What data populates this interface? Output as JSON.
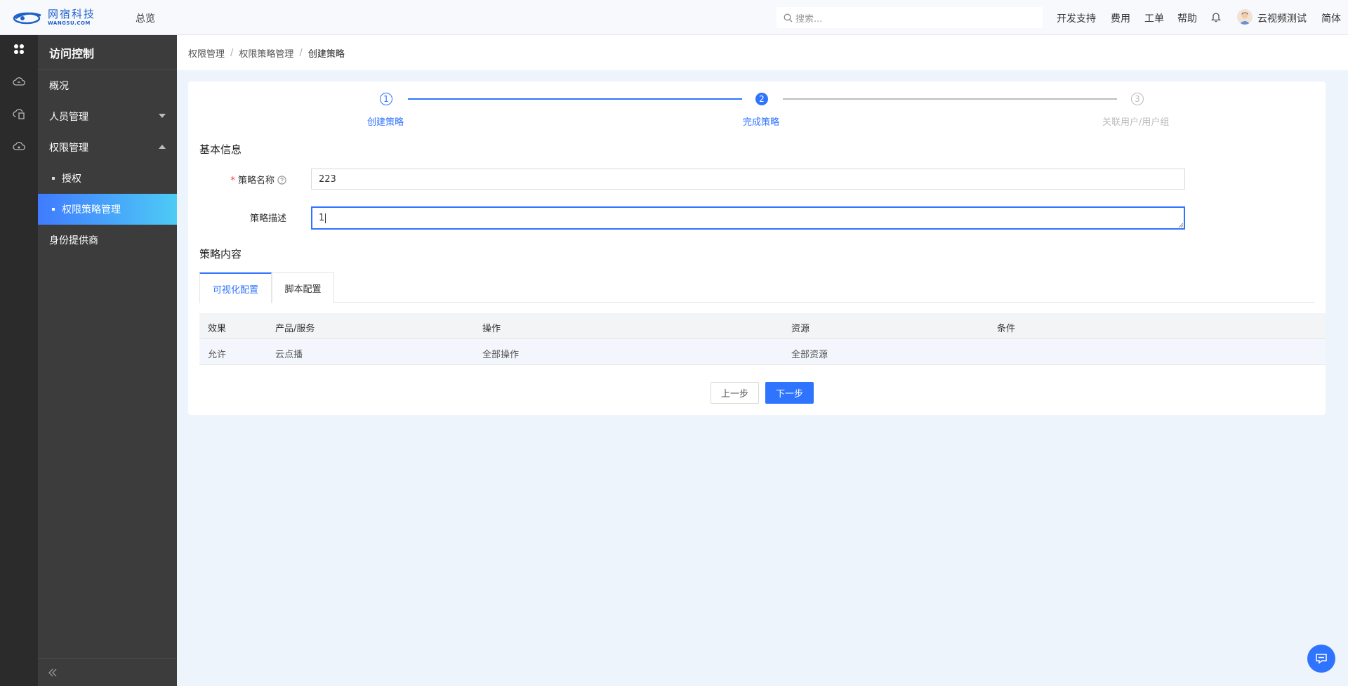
{
  "header": {
    "logo_cn": "网宿科技",
    "logo_en": "WANGSU.COM",
    "overview": "总览",
    "search_placeholder": "搜索...",
    "nav": [
      "开发支持",
      "费用",
      "工单",
      "帮助"
    ],
    "username": "云视频测试",
    "language": "简体"
  },
  "sidebar": {
    "title": "访问控制",
    "items": [
      {
        "label": "概况"
      },
      {
        "label": "人员管理"
      },
      {
        "label": "权限管理"
      },
      {
        "label": "授权"
      },
      {
        "label": "权限策略管理"
      },
      {
        "label": "身份提供商"
      }
    ]
  },
  "breadcrumb": [
    "权限管理",
    "权限策略管理",
    "创建策略"
  ],
  "steps": [
    {
      "num": "1",
      "label": "创建策略",
      "state": "done"
    },
    {
      "num": "2",
      "label": "完成策略",
      "state": "active"
    },
    {
      "num": "3",
      "label": "关联用户/用户组",
      "state": "pending"
    }
  ],
  "form": {
    "section_basic": "基本信息",
    "name_label": "策略名称",
    "name_value": "223",
    "desc_label": "策略描述",
    "desc_value": "1",
    "section_content": "策略内容"
  },
  "tabs": [
    "可视化配置",
    "脚本配置"
  ],
  "table": {
    "headers": [
      "效果",
      "产品/服务",
      "操作",
      "资源",
      "条件"
    ],
    "rows": [
      [
        "允许",
        "云点播",
        "全部操作",
        "全部资源",
        ""
      ]
    ]
  },
  "buttons": {
    "prev": "上一步",
    "next": "下一步"
  },
  "colors": {
    "primary": "#2f74ff",
    "rail": "#2b2b2b",
    "sidenav": "#3c3c3c"
  }
}
